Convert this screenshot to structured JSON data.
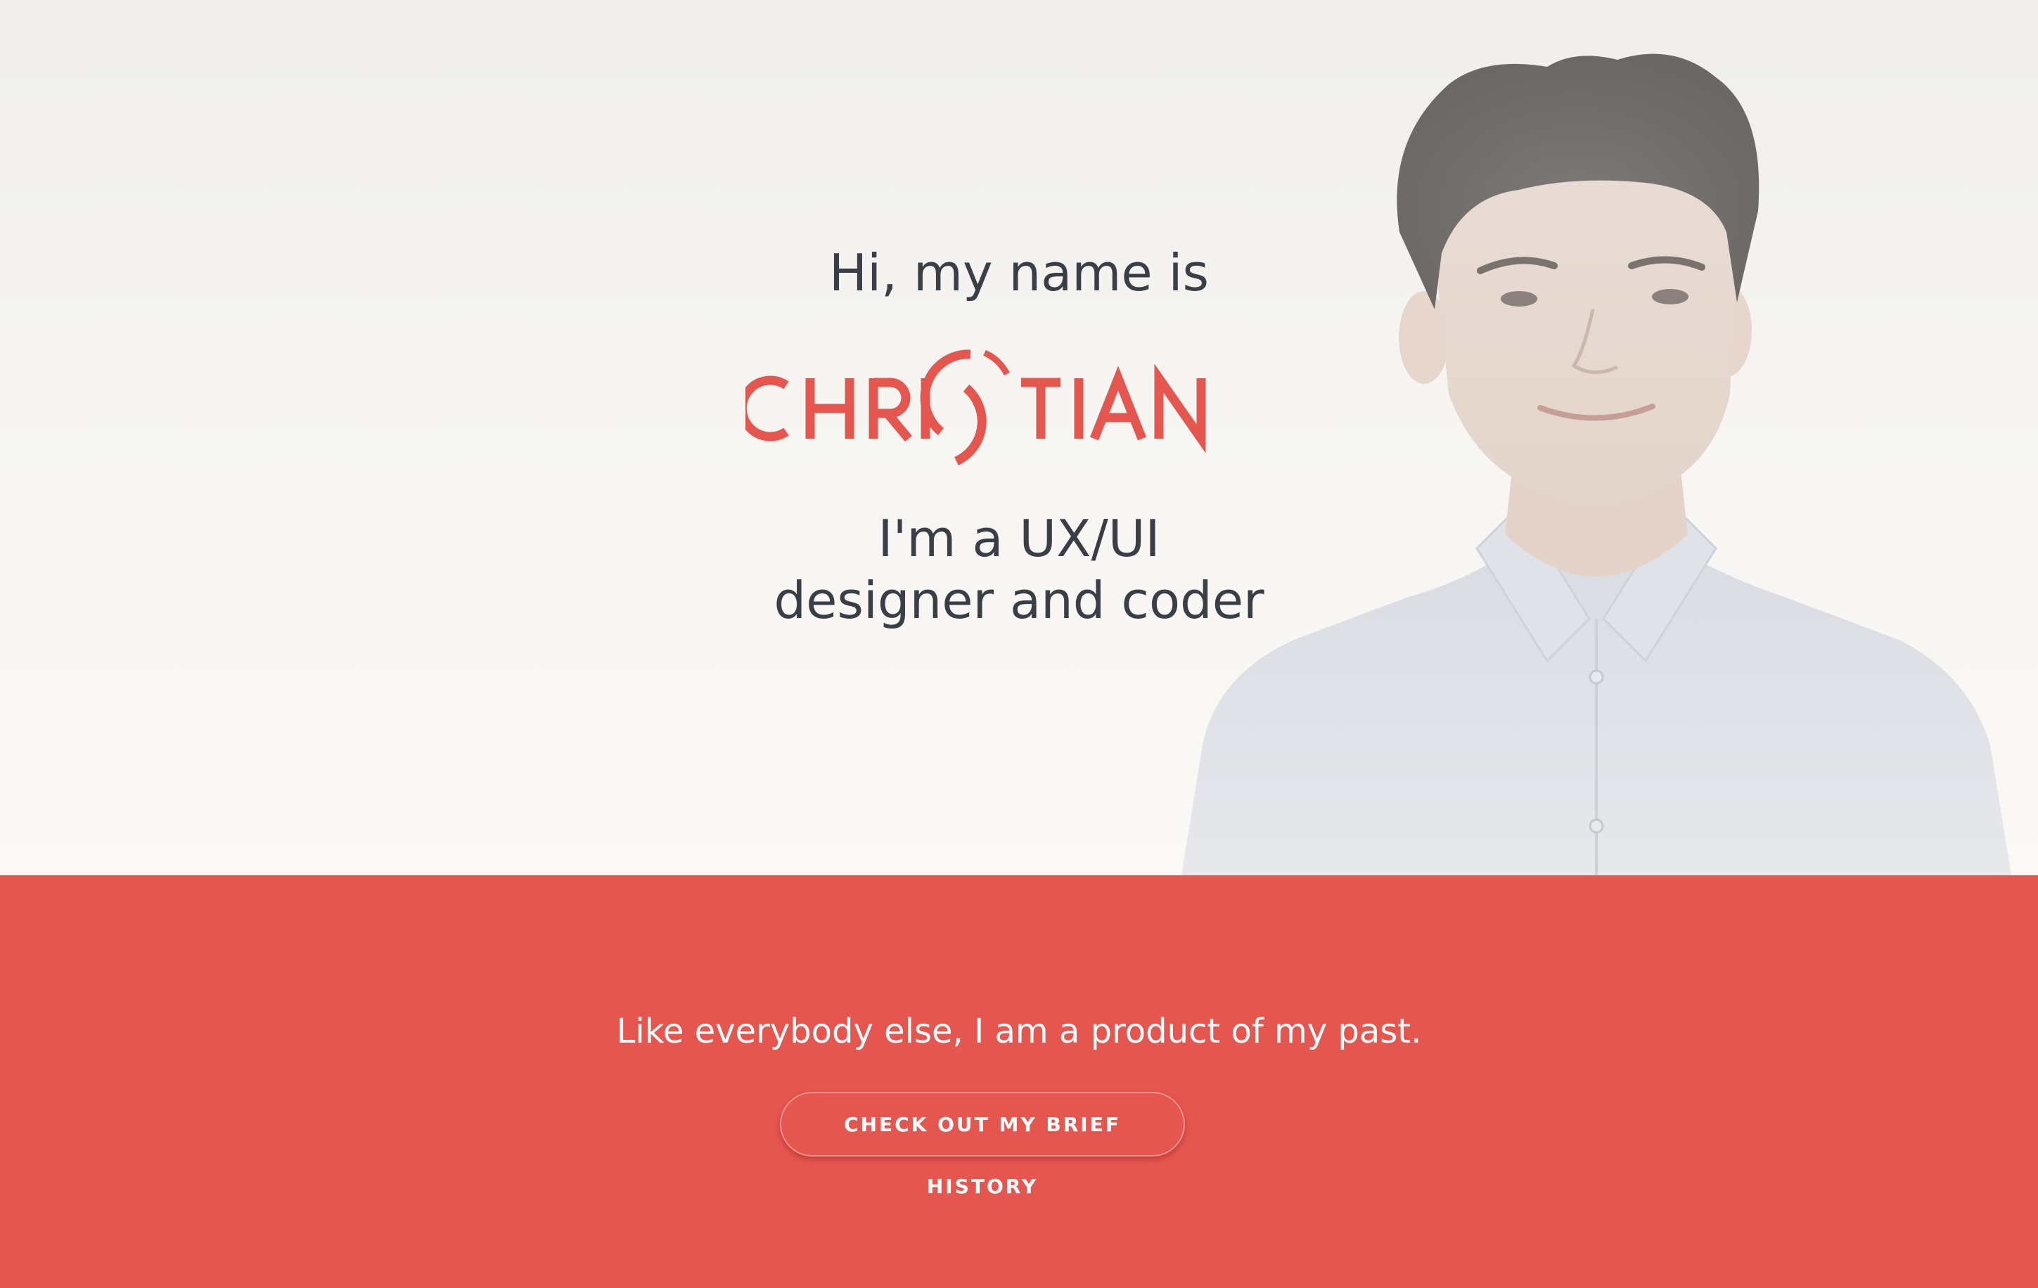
{
  "hero": {
    "greeting": "Hi, my name is",
    "logo_text": "CHRISTIAN",
    "tagline_line1": "I'm a UX/UI",
    "tagline_line2": "designer and coder"
  },
  "banner": {
    "quote": "Like everybody else, I am a product of my past.",
    "cta_label": "CHECK OUT MY BRIEF HISTORY"
  },
  "colors": {
    "accent": "#e5564f",
    "heading_text": "#3a3f47",
    "banner_text": "#ffffff"
  }
}
